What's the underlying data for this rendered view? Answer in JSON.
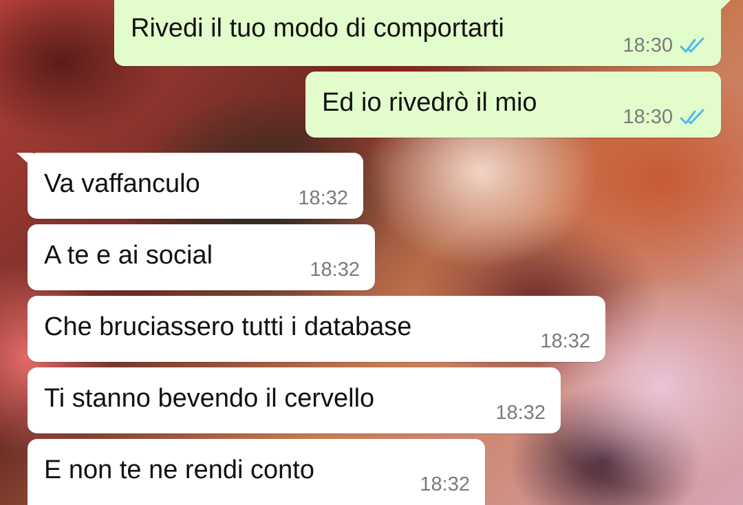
{
  "messages": [
    {
      "direction": "outgoing",
      "text": "Rivedi il tuo modo di comportarti",
      "time": "18:30",
      "status_icon": "double-check-icon"
    },
    {
      "direction": "outgoing",
      "text": "Ed io rivedrò il mio",
      "time": "18:30",
      "status_icon": "double-check-icon"
    },
    {
      "direction": "incoming",
      "text": "Va vaffanculo",
      "time": "18:32"
    },
    {
      "direction": "incoming",
      "text": "A te e ai social",
      "time": "18:32"
    },
    {
      "direction": "incoming",
      "text": "Che bruciassero tutti i database",
      "time": "18:32"
    },
    {
      "direction": "incoming",
      "text": "Ti stanno bevendo il cervello",
      "time": "18:32"
    },
    {
      "direction": "incoming",
      "text": "E non te ne rendi conto",
      "time": "18:32"
    }
  ],
  "colors": {
    "outgoing_bubble": "#e2fdcb",
    "incoming_bubble": "#ffffff",
    "read_tick": "#4fb6ec",
    "timestamp": "#7a7a7a"
  }
}
